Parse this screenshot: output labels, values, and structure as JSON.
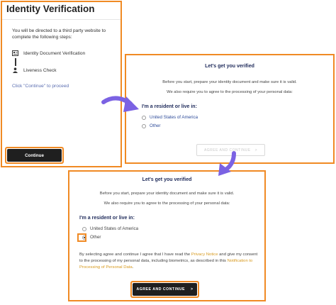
{
  "accent_color": "#f08a24",
  "arrow_color": "#7b62e3",
  "panel1": {
    "title": "Identity Verification",
    "intro": "You will be directed to a third party website to complete the following steps:",
    "steps": [
      {
        "label": "Identity Document Verification",
        "icon": "id-card-icon"
      },
      {
        "label": "Liveness Check",
        "icon": "person-icon"
      }
    ],
    "proceed_hint": "Click \"Continue\" to proceed",
    "continue_label": "Continue"
  },
  "panel2": {
    "heading": "Let's get you verified",
    "line1": "Before you start, prepare your identity document and make sure it is valid.",
    "line2": "We also require you to agree to the processing of your personal data:",
    "resident_label": "I'm a resident or live in:",
    "options": [
      "United States of America",
      "Other"
    ],
    "agree_label": "AGREE AND CONTINUE",
    "agree_chevron": ">"
  },
  "panel3": {
    "heading": "Let's get you verified",
    "line1": "Before you start, prepare your identity document and make sure it is valid.",
    "line2": "We also require you to agree to the processing of your personal data:",
    "resident_label": "I'm a resident or live in:",
    "options": [
      "United States of America",
      "Other"
    ],
    "selected_option": "Other",
    "consent_part1": "By selecting agree and continue I agree that I have read the ",
    "privacy_link": "Privacy Notice",
    "consent_part2": " and give my consent to the processing of my personal data, including biometrics, as described in this ",
    "notification_link": "Notification to Processing of Personal Data",
    "consent_part3": ".",
    "agree_label": "AGREE AND CONTINUE",
    "agree_chevron": ">"
  }
}
